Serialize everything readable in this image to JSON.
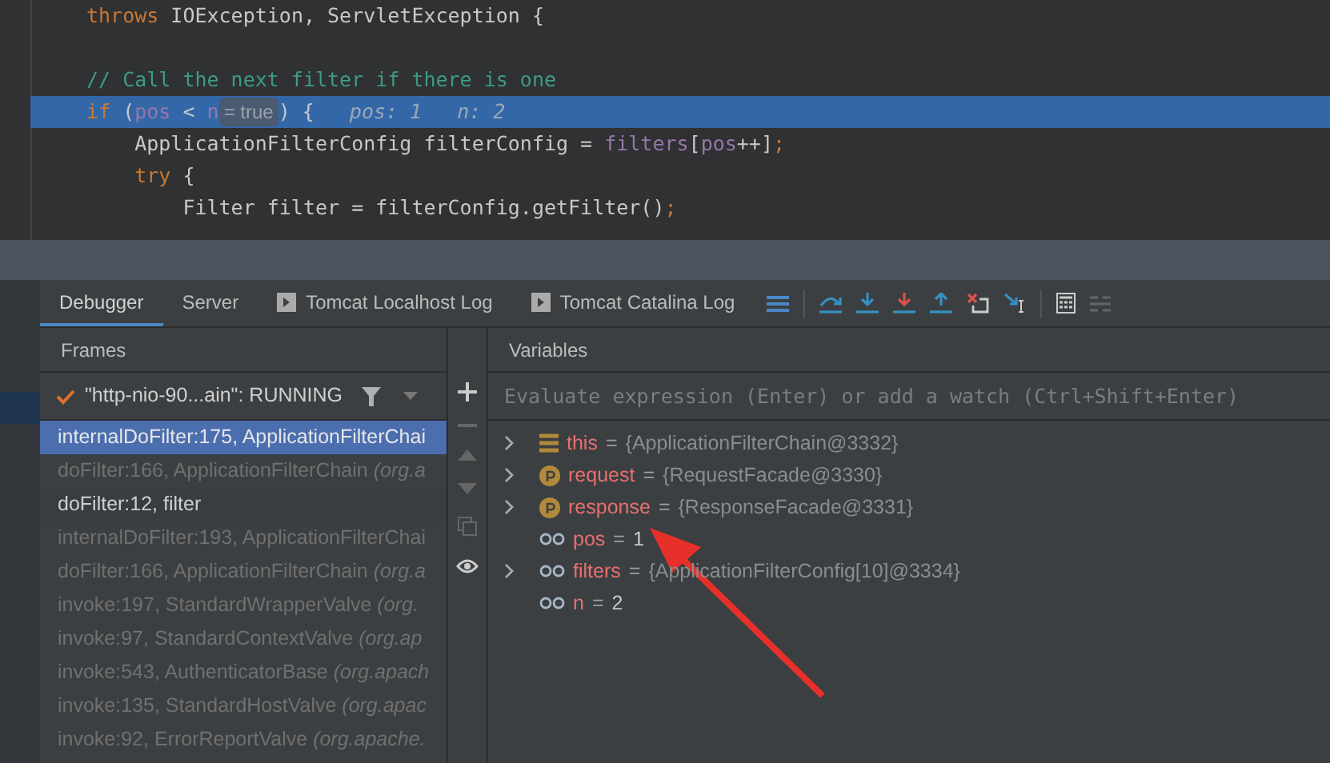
{
  "editor": {
    "lines": [
      {
        "selected": false,
        "tokens": [
          {
            "kind": "keyword",
            "text": "throws"
          },
          {
            "kind": "plain",
            "text": " IOException, ServletException {"
          }
        ]
      },
      {
        "selected": false
      },
      {
        "selected": false,
        "tokens": [
          {
            "kind": "comment",
            "text": "// Call the next filter if there is one"
          }
        ]
      },
      {
        "selected": true,
        "tokens": [
          {
            "kind": "keyword",
            "text": "if"
          },
          {
            "kind": "plain",
            "text": " ("
          },
          {
            "kind": "field",
            "text": "pos"
          },
          {
            "kind": "plain",
            "text": " < "
          },
          {
            "kind": "field",
            "text": "n"
          },
          {
            "kind": "hint",
            "text": "= true"
          },
          {
            "kind": "plain",
            "text": ") {"
          },
          {
            "kind": "inline",
            "text": "pos: 1"
          },
          {
            "kind": "inline",
            "text": "n: 2"
          }
        ]
      },
      {
        "selected": false,
        "tokens": [
          {
            "kind": "plain",
            "text": "    ApplicationFilterConfig filterConfig = "
          },
          {
            "kind": "field",
            "text": "filters"
          },
          {
            "kind": "plain",
            "text": "["
          },
          {
            "kind": "field",
            "text": "pos"
          },
          {
            "kind": "plain",
            "text": "++]"
          },
          {
            "kind": "keyword",
            "text": ";"
          }
        ]
      },
      {
        "selected": false,
        "tokens": [
          {
            "kind": "keyword",
            "text": "    try"
          },
          {
            "kind": "plain",
            "text": " {"
          }
        ]
      },
      {
        "selected": false,
        "tokens": [
          {
            "kind": "plain",
            "text": "        Filter filter = filterConfig.getFilter()"
          },
          {
            "kind": "keyword",
            "text": ";"
          }
        ]
      }
    ]
  },
  "tabs": [
    {
      "label": "Debugger",
      "selected": true,
      "icon": false
    },
    {
      "label": "Server",
      "selected": false,
      "icon": false
    },
    {
      "label": "Tomcat Localhost Log",
      "selected": false,
      "icon": true
    },
    {
      "label": "Tomcat Catalina Log",
      "selected": false,
      "icon": true
    }
  ],
  "frames": {
    "title": "Frames",
    "thread": "\"http-nio-90...ain\": RUNNING",
    "items": [
      {
        "text": "internalDoFilter:175, ApplicationFilterChai",
        "selected": true,
        "library": false
      },
      {
        "text": "doFilter:166, ApplicationFilterChain *(org.a*",
        "selected": false,
        "library": true
      },
      {
        "text": "doFilter:12, filter",
        "selected": false,
        "library": false
      },
      {
        "text": "internalDoFilter:193, ApplicationFilterChai",
        "selected": false,
        "library": true
      },
      {
        "text": "doFilter:166, ApplicationFilterChain *(org.a*",
        "selected": false,
        "library": true
      },
      {
        "text": "invoke:197, StandardWrapperValve *(org.*",
        "selected": false,
        "library": true
      },
      {
        "text": "invoke:97, StandardContextValve *(org.ap*",
        "selected": false,
        "library": true
      },
      {
        "text": "invoke:543, AuthenticatorBase *(org.apach*",
        "selected": false,
        "library": true
      },
      {
        "text": "invoke:135, StandardHostValve *(org.apac*",
        "selected": false,
        "library": true
      },
      {
        "text": "invoke:92, ErrorReportValve *(org.apache.*",
        "selected": false,
        "library": true
      }
    ]
  },
  "variables": {
    "title": "Variables",
    "placeholder": "Evaluate expression (Enter) or add a watch (Ctrl+Shift+Enter)",
    "items": [
      {
        "kind": "object",
        "expandable": true,
        "name": "this",
        "separator": "=",
        "value": "{ApplicationFilterChain@3332}"
      },
      {
        "kind": "param",
        "expandable": true,
        "name": "request",
        "separator": "=",
        "value": "{RequestFacade@3330}"
      },
      {
        "kind": "param",
        "expandable": true,
        "name": "response",
        "separator": "=",
        "value": "{ResponseFacade@3331}"
      },
      {
        "kind": "local",
        "expandable": false,
        "name": "pos",
        "separator": "=",
        "value": "1"
      },
      {
        "kind": "local",
        "expandable": true,
        "name": "filters",
        "separator": "=",
        "value": "{ApplicationFilterConfig[10]@3334}"
      },
      {
        "kind": "local",
        "expandable": false,
        "name": "n",
        "separator": "=",
        "value": "2"
      }
    ]
  }
}
